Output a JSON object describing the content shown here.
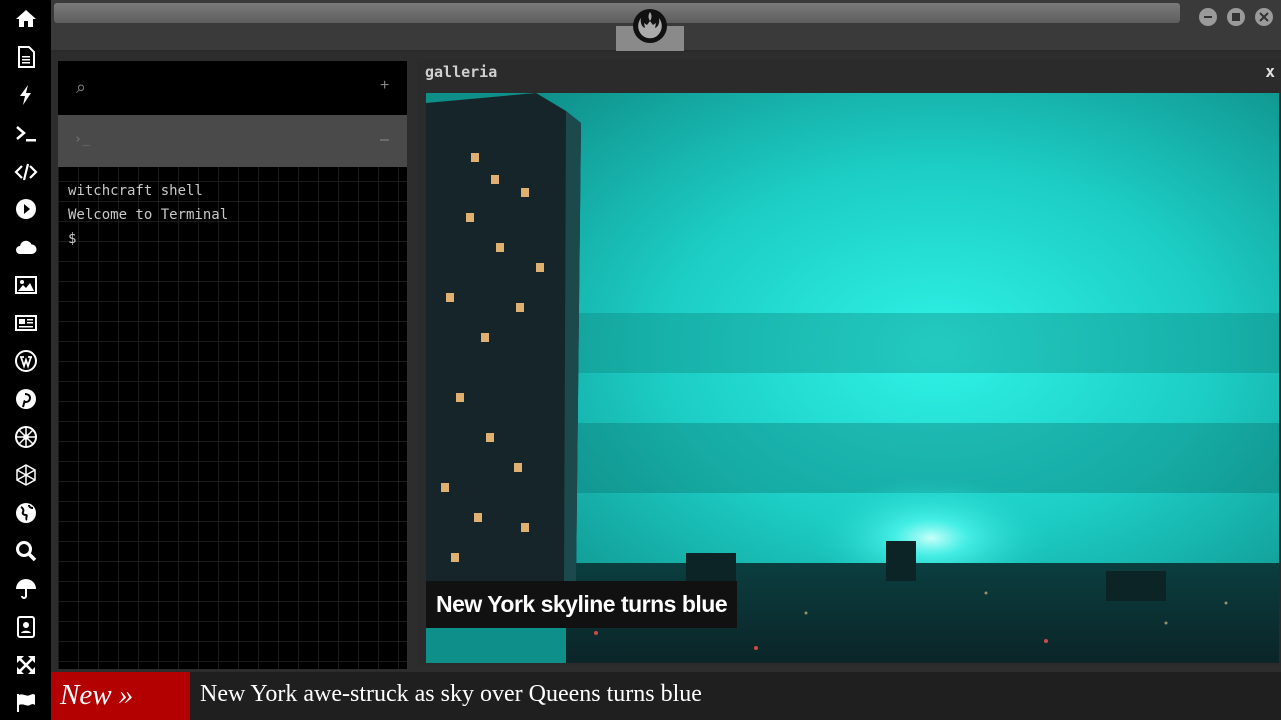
{
  "sidebar": {
    "icons": [
      "home-icon",
      "document-icon",
      "bolt-icon",
      "terminal-icon",
      "code-icon",
      "play-icon",
      "cloud-icon",
      "image-icon",
      "newspaper-icon",
      "wordpress-icon",
      "pinterest-icon",
      "empire-icon",
      "hexagon-network-icon",
      "globe-icon",
      "search-icon",
      "umbrella-icon",
      "contacts-icon",
      "expand-icon",
      "flag-icon"
    ]
  },
  "topbar": {
    "logo": "rebel-alliance-icon"
  },
  "terminal": {
    "search_icon": "⌕",
    "add_label": "+",
    "prompt_icon": "›_",
    "minimize_label": "–",
    "lines": [
      "witchcraft shell",
      "Welcome to Terminal",
      "$"
    ]
  },
  "galleria": {
    "title": "galleria",
    "close_label": "x",
    "caption": "New York skyline turns blue"
  },
  "ticker": {
    "badge": "New »",
    "headline": "New York awe-struck as sky over Queens turns blue"
  },
  "colors": {
    "sidebar_bg": "#000000",
    "ticker_badge": "#b30000",
    "sky": "#19c8c0"
  }
}
